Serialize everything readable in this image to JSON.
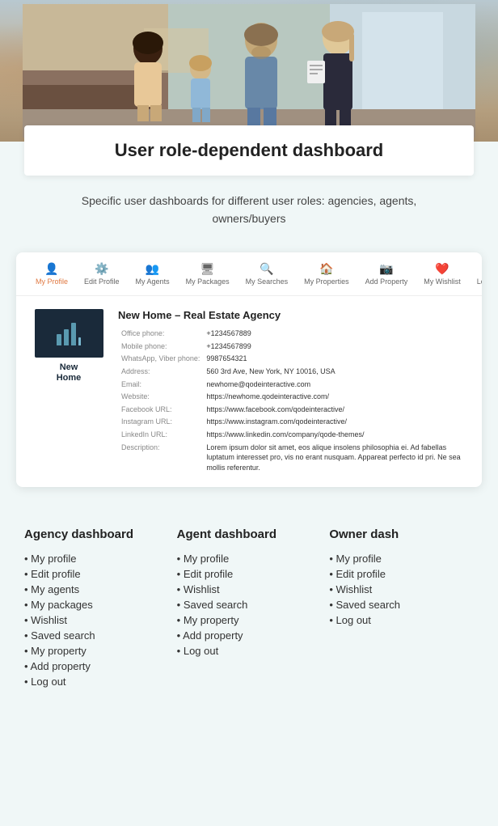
{
  "hero": {
    "alt": "Family with real estate agent"
  },
  "title": {
    "main": "User role-dependent dashboard"
  },
  "subtitle": {
    "text": "Specific user dashboards for different user roles: agencies, agents, owners/buyers"
  },
  "nav": {
    "items": [
      {
        "label": "My Profile",
        "icon": "👤",
        "active": true
      },
      {
        "label": "Edit Profile",
        "icon": "⚙️",
        "active": false
      },
      {
        "label": "My Agents",
        "icon": "👥",
        "active": false
      },
      {
        "label": "My Packages",
        "icon": "🖥",
        "active": false
      },
      {
        "label": "My Searches",
        "icon": "🔍",
        "active": false
      },
      {
        "label": "My Properties",
        "icon": "🏠",
        "active": false
      },
      {
        "label": "Add Property",
        "icon": "📷",
        "active": false
      },
      {
        "label": "My Wishlist",
        "icon": "❤️",
        "active": false
      },
      {
        "label": "Log Out",
        "icon": "↩",
        "active": false
      }
    ]
  },
  "agency": {
    "title": "New Home – Real Estate Agency",
    "logo_line1": "New",
    "logo_line2": "Home",
    "fields": [
      {
        "label": "Office phone:",
        "value": "+1234567889"
      },
      {
        "label": "Mobile phone:",
        "value": "+1234567899"
      },
      {
        "label": "WhatsApp, Viber phone:",
        "value": "9987654321"
      },
      {
        "label": "Address:",
        "value": "560 3rd Ave, New York, NY 10016, USA"
      },
      {
        "label": "Email:",
        "value": "newhome@qodeinteractive.com"
      },
      {
        "label": "Website:",
        "value": "https://newhome.qodeinteractive.com/"
      },
      {
        "label": "Facebook URL:",
        "value": "https://www.facebook.com/qodeinteractive/"
      },
      {
        "label": "Instagram URL:",
        "value": "https://www.instagram.com/qodeinteractive/"
      },
      {
        "label": "LinkedIn URL:",
        "value": "https://www.linkedin.com/company/qode-themes/"
      },
      {
        "label": "Description:",
        "value": "Lorem ipsum dolor sit amet, eos alique insolens philosophia ei. Ad fabellas luptatum interesset pro, vis no erant nusquam. Appareat perfecto id pri. Ne sea mollis referentur."
      }
    ]
  },
  "columns": [
    {
      "title": "Agency dashboard",
      "items": [
        "My profile",
        "Edit profile",
        "My agents",
        "My packages",
        "Wishlist",
        "Saved search",
        "My property",
        "Add property",
        "Log out"
      ]
    },
    {
      "title": "Agent dashboard",
      "items": [
        "My profile",
        "Edit profile",
        "Wishlist",
        "Saved search",
        "My property",
        "Add property",
        "Log out"
      ]
    },
    {
      "title": "Owner dash",
      "items": [
        "My profile",
        "Edit profile",
        "Wishlist",
        "Saved search",
        "Log out"
      ]
    }
  ]
}
